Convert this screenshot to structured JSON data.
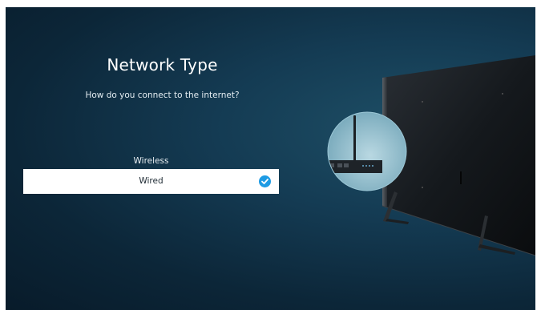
{
  "page": {
    "title": "Network Type",
    "subtitle": "How do you connect to the internet?"
  },
  "options": [
    {
      "label": "Wireless",
      "selected": false
    },
    {
      "label": "Wired",
      "selected": true
    }
  ],
  "icons": {
    "selected_check": "check-circle-icon"
  },
  "colors": {
    "background": "#0f2f44",
    "selected_row": "#ffffff",
    "check_accent": "#1e9be4"
  }
}
